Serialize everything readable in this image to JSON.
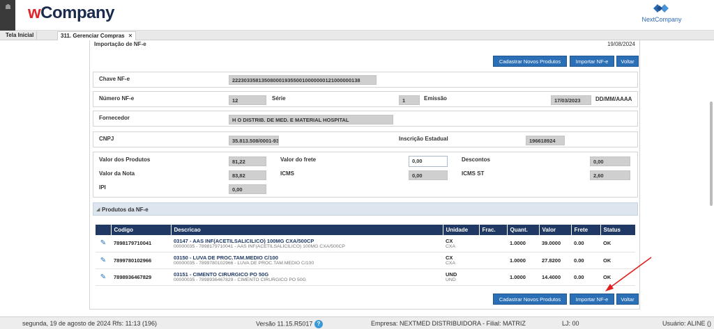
{
  "header": {
    "logo_w": "w",
    "logo_company": "Company",
    "partner_name": "NextCompany"
  },
  "tabs": [
    {
      "label": "Tela Inicial"
    },
    {
      "label": "311. Gerenciar Compras",
      "close": "✕"
    }
  ],
  "page": {
    "title": "Importação de NF-e",
    "date": "19/08/2024"
  },
  "toolbar": {
    "cadastrar_label": "Cadastrar Novos Produtos",
    "importar_label": "Importar NF-e",
    "voltar_label": "Voltar"
  },
  "form": {
    "chave_label": "Chave NF-e",
    "chave_value": "22230335813508000193550010000000121000000138",
    "numero_label": "Número NF-e",
    "numero_value": "12",
    "serie_label": "Série",
    "serie_value": "1",
    "emissao_label": "Emissão",
    "emissao_value": "17/03/2023",
    "emissao_format": "DD/MM/AAAA",
    "fornecedor_label": "Fornecedor",
    "fornecedor_value": "H O DISTRIB. DE MED. E MATERIAL HOSPITAL",
    "cnpj_label": "CNPJ",
    "cnpj_value": "35.813.508/0001-93",
    "ie_label": "Inscrição Estadual",
    "ie_value": "196618924",
    "valor_produtos_label": "Valor dos Produtos",
    "valor_produtos_value": "81,22",
    "valor_frete_label": "Valor do frete",
    "valor_frete_value": "0,00",
    "descontos_label": "Descontos",
    "descontos_value": "0,00",
    "valor_nota_label": "Valor da Nota",
    "valor_nota_value": "83,82",
    "icms_label": "ICMS",
    "icms_value": "0,00",
    "icms_st_label": "ICMS ST",
    "icms_st_value": "2,60",
    "ipi_label": "IPI",
    "ipi_value": "0,00"
  },
  "products": {
    "section_title": "Produtos da NF-e",
    "columns": [
      "Codigo",
      "Descricao",
      "Unidade",
      "Frac.",
      "Quant.",
      "Valor",
      "Frete",
      "Status"
    ],
    "rows": [
      {
        "codigo": "7898179710041",
        "desc": "03147 - AAS INF(ACETILSALICILICO) 100MG CXA/500CP",
        "desc_sub": "00000035 - 7898179710041 - AAS INF(ACETILSALICILICO) 100MG CXA/500CP",
        "unidade": "CX",
        "unidade_sub": "CXA",
        "frac": "",
        "quant": "1.0000",
        "valor": "39.0000",
        "frete": "0.00",
        "status": "OK"
      },
      {
        "codigo": "7899780102966",
        "desc": "03150 - LUVA DE PROC.TAM.MEDIO C/100",
        "desc_sub": "00000035 - 7899780102966 - LUVA DE PROC.TAM.MEDIO C/100",
        "unidade": "CX",
        "unidade_sub": "CXA",
        "frac": "",
        "quant": "1.0000",
        "valor": "27.8200",
        "frete": "0.00",
        "status": "OK"
      },
      {
        "codigo": "7898936467829",
        "desc": "03151 - CIMENTO CIRURGICO PO 50G",
        "desc_sub": "00000035 - 7898936467829 - CIMENTO CIRURGICO PO 50G",
        "unidade": "UND",
        "unidade_sub": "UND",
        "frac": "",
        "quant": "1.0000",
        "valor": "14.4000",
        "frete": "0.00",
        "status": "OK"
      }
    ]
  },
  "statusbar": {
    "datetime": "segunda, 19 de agosto de 2024  Rfs: 11:13 (196)",
    "version": "Versão 11.15.R5017",
    "help": "?",
    "empresa": "Empresa: NEXTMED DISTRIBUIDORA - Filial: MATRIZ",
    "lj": "LJ: 00",
    "usuario": "Usuário: ALINE ()"
  },
  "colors": {
    "button": "#2b6fb6",
    "table_header": "#1f3864",
    "logo_red": "#e1252b",
    "logo_dark": "#1a2b4c",
    "arrow": "#e02020"
  }
}
